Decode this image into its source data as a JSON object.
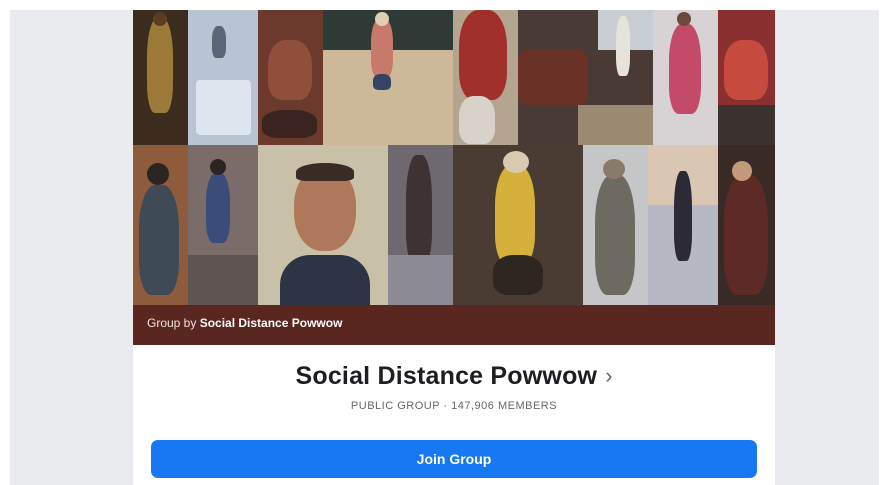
{
  "cover": {
    "caption_prefix": "Group by",
    "caption_group": "Social Distance Powwow",
    "caption_bg": "#5a2620"
  },
  "group": {
    "name": "Social Distance Powwow",
    "chevron": "›",
    "meta": "PUBLIC GROUP · 147,906 MEMBERS"
  },
  "actions": {
    "join_label": "Join Group",
    "join_color": "#1877f2"
  }
}
